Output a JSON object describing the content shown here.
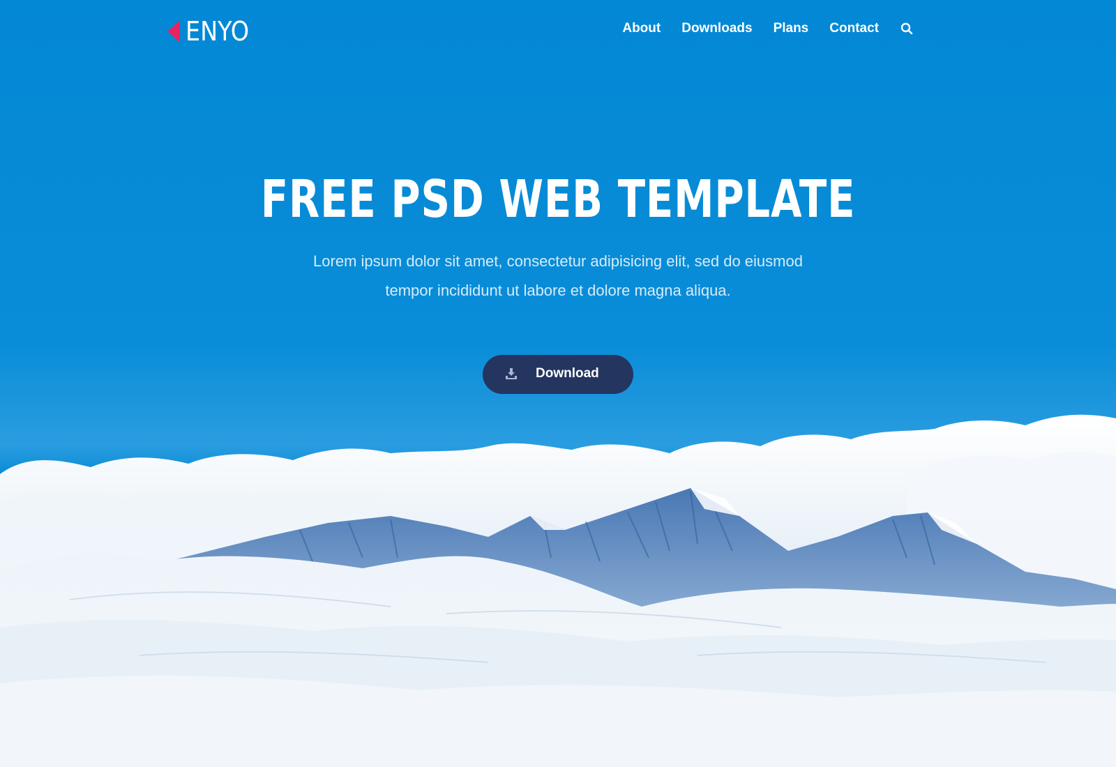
{
  "brand": {
    "name": "ENYO",
    "accent": "#e8245f"
  },
  "nav": {
    "items": [
      {
        "label": "About"
      },
      {
        "label": "Downloads"
      },
      {
        "label": "Plans"
      },
      {
        "label": "Contact"
      }
    ],
    "search_icon": "search-icon"
  },
  "hero": {
    "title": "FREE PSD WEB TEMPLATE",
    "subtitle_line1": "Lorem ipsum dolor sit amet, consectetur adipisicing elit, sed do eiusmod",
    "subtitle_line2": "tempor incididunt ut labore et dolore magna aliqua.",
    "button_label": "Download",
    "button_icon": "download-icon",
    "button_color": "#243560",
    "sky_color": "#0289d6"
  }
}
